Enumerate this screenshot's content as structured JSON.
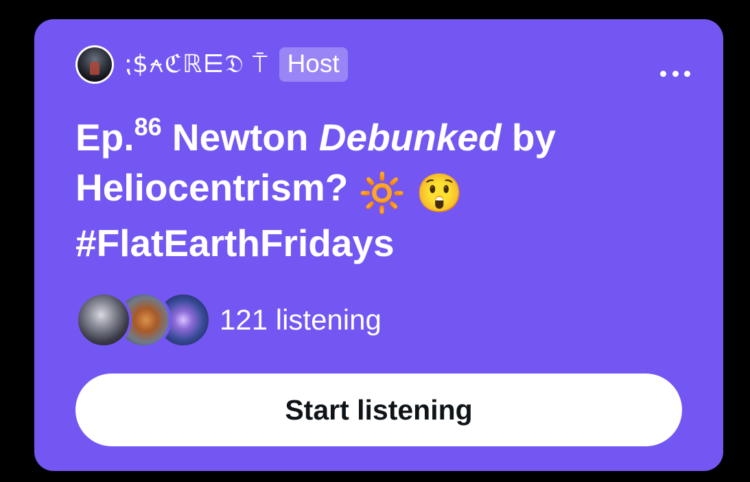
{
  "space_card": {
    "host": {
      "name": "⁏$⍲ℭℝ⋿𝔇 ⍑",
      "badge": "Host"
    },
    "more_menu_icon": "more-horizontal-icon",
    "title": {
      "prefix": "Ep.",
      "episode_number": "86",
      "part1": " Newton ",
      "emphasis": "Debunked",
      "part2": " by Heliocentrism? ",
      "emoji_sun": "🔆",
      "emoji_face": "😲",
      "hashtag": "#FlatEarthFridays"
    },
    "listeners": {
      "count_text": "121 listening"
    },
    "start_button_label": "Start listening",
    "colors": {
      "card_background": "#7457f3",
      "page_background": "#000000",
      "button_background": "#ffffff",
      "button_text": "#0f1419"
    }
  }
}
